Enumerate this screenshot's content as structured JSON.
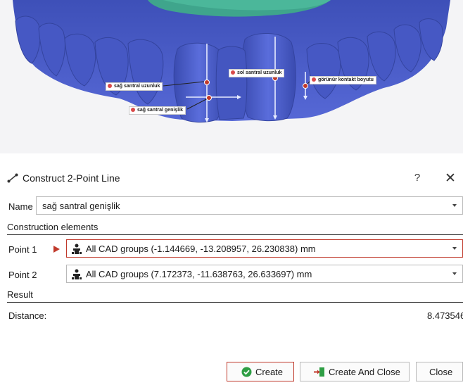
{
  "viewport": {
    "labels": {
      "sag_uzunluk": "sağ santral uzunluk",
      "sol_uzunluk": "sol santral uzunluk",
      "kontakt": "görünür kontakt boyutu",
      "sag_genislik": "sağ santral genişlik"
    }
  },
  "dialog": {
    "title": "Construct 2-Point Line",
    "help": "?",
    "close": "✕",
    "name_label": "Name",
    "name_value": "sağ santral genişlik",
    "construction_section": "Construction elements",
    "point1_label": "Point 1",
    "point1_value": "All CAD groups (-1.144669, -13.208957, 26.230838) mm",
    "point2_label": "Point 2",
    "point2_value": "All CAD groups (7.172373, -11.638763, 26.633697) mm",
    "result_section": "Result",
    "distance_label": "Distance:",
    "distance_value": "8.473546",
    "buttons": {
      "create": "Create",
      "create_close": "Create And Close",
      "close": "Close"
    }
  },
  "colors": {
    "tooth_blue": "#4b5fc9",
    "gum_teal": "#3fa58c",
    "accent_red": "#c0392b",
    "create_green": "#2e9e44"
  }
}
